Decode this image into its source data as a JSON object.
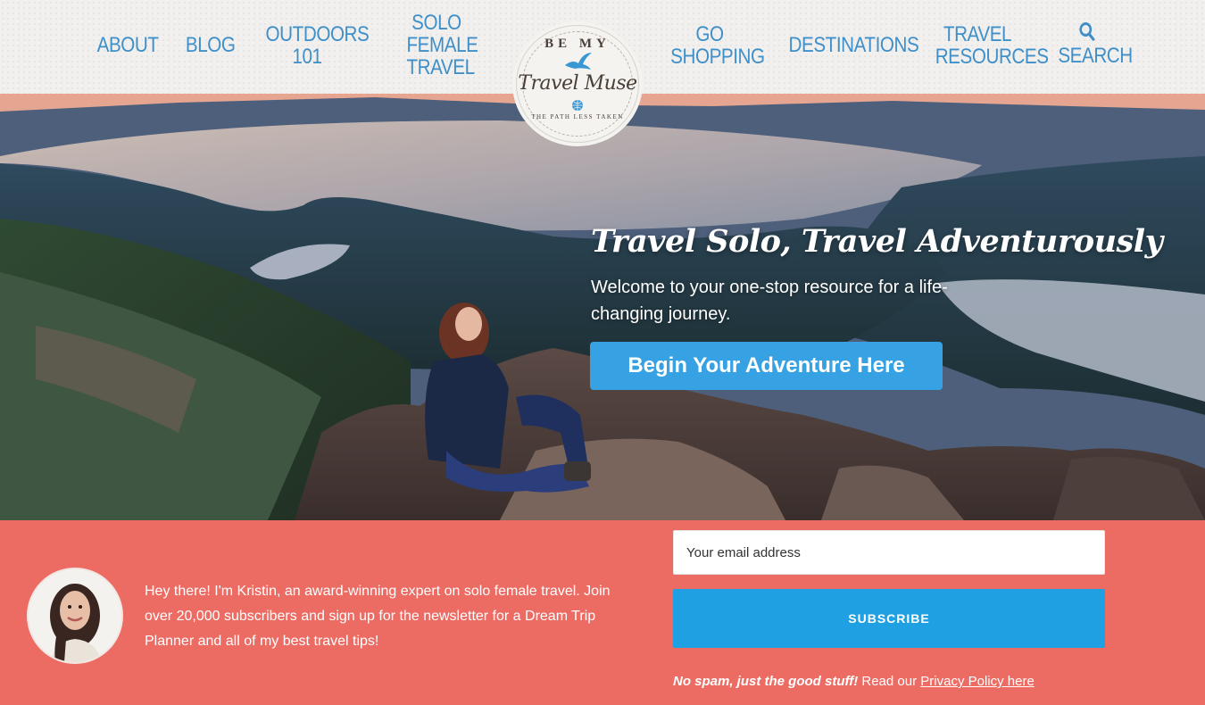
{
  "nav": {
    "about": "ABOUT",
    "blog": "BLOG",
    "outdoors_line1": "OUTDOORS",
    "outdoors_line2": "101",
    "solo_line1": "SOLO",
    "solo_line2": "FEMALE",
    "solo_line3": "TRAVEL",
    "shopping_line1": "GO",
    "shopping_line2": "SHOPPING",
    "destinations": "DESTINATIONS",
    "resources_line1": "TRAVEL",
    "resources_line2": "RESOURCES",
    "search": "SEARCH",
    "search_icon": "search-icon"
  },
  "logo": {
    "top": "BE MY",
    "script": "Travel Muse",
    "tagline": "THE PATH LESS TAKEN"
  },
  "hero": {
    "headline": "Travel Solo, Travel Adventurously",
    "subtext": "Welcome to your one-stop resource for a life-changing journey.",
    "cta": "Begin Your Adventure Here"
  },
  "newsletter": {
    "intro": "Hey there! I'm Kristin, an award-winning expert on solo female travel. Join over 20,000 subscribers and sign up for the newsletter for a Dream Trip Planner and all of my best travel tips!",
    "email_placeholder": "Your email address",
    "subscribe": "SUBSCRIBE",
    "no_spam": "No spam, just the good stuff!",
    "read_our": " Read our ",
    "privacy_link": "Privacy Policy here"
  },
  "colors": {
    "nav_text": "#3f8fc9",
    "cta_blue": "#37a2e3",
    "subscribe_blue": "#1fa0e3",
    "coral": "#ec6b63"
  }
}
